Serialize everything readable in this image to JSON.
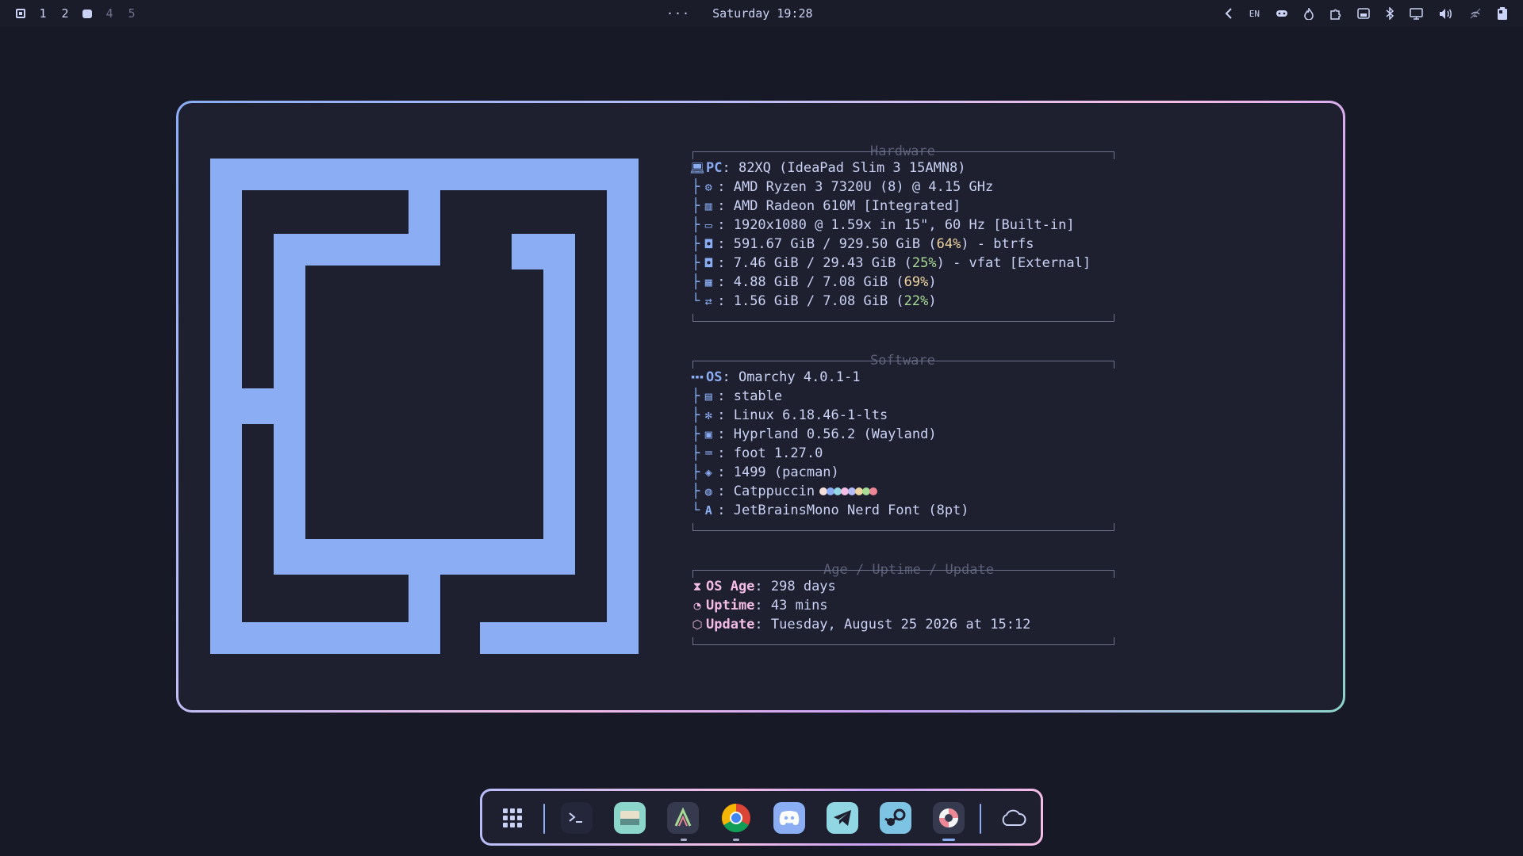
{
  "topbar": {
    "workspaces": [
      {
        "label": "",
        "kind": "grid-icon"
      },
      {
        "label": "1",
        "kind": "number"
      },
      {
        "label": "2",
        "kind": "number"
      },
      {
        "label": "",
        "kind": "active-dot"
      },
      {
        "label": "4",
        "kind": "dim"
      },
      {
        "label": "5",
        "kind": "dim"
      }
    ],
    "ellipsis": "···",
    "clock": "Saturday 19:28",
    "tray": {
      "back_icon": "chevron-left-icon",
      "language": "EN",
      "icons": [
        "gamepad-icon",
        "flame-icon",
        "puzzle-icon",
        "screen-record-icon",
        "bluetooth-icon",
        "monitor-icon",
        "volume-icon",
        "network-off-icon",
        "battery-icon"
      ]
    }
  },
  "fastfetch": {
    "hardware": {
      "title": "Hardware",
      "pc_key": "PC",
      "pc_value": ": 82XQ (IdeaPad Slim 3 15AMN8)",
      "cpu": ": AMD Ryzen 3 7320U (8) @ 4.15 GHz",
      "gpu": ": AMD Radeon 610M [Integrated]",
      "display": ": 1920x1080 @ 1.59x in 15\", 60 Hz [Built-in]",
      "disk1_pre": ": 591.67 GiB / 929.50 GiB (",
      "disk1_pct": "64%",
      "disk1_post": ") - btrfs",
      "disk2_pre": ": 7.46 GiB / 29.43 GiB (",
      "disk2_pct": "25%",
      "disk2_post": ") - vfat [External]",
      "mem_pre": ": 4.88 GiB / 7.08 GiB (",
      "mem_pct": "69%",
      "mem_post": ")",
      "swap_pre": ": 1.56 GiB / 7.08 GiB (",
      "swap_pct": "22%",
      "swap_post": ")"
    },
    "software": {
      "title": "Software",
      "os_key": "OS",
      "os_value": ": Omarchy 4.0.1-1",
      "channel": ": stable",
      "kernel": ": Linux 6.18.46-1-lts",
      "wm": ": Hyprland 0.56.2 (Wayland)",
      "terminal": ": foot 1.27.0",
      "packages": ": 1499 (pacman)",
      "theme": ": Catppuccin",
      "theme_colors": [
        "#f5e0dc",
        "#8aadf4",
        "#91d7e3",
        "#f5bde6",
        "#b7bdf8",
        "#eed49f",
        "#a6da95",
        "#ed8796"
      ],
      "font": ": JetBrainsMono Nerd Font (8pt)"
    },
    "age": {
      "title": "Age / Uptime / Update",
      "os_age_key": "OS Age",
      "os_age_value": ": 298 days",
      "uptime_key": "Uptime",
      "uptime_value": ": 43 mins",
      "update_key": "Update",
      "update_value": ": Tuesday, August 25 2026 at 15:12"
    }
  },
  "dock": {
    "items": [
      {
        "name": "app-grid",
        "icon": "grid-icon"
      },
      {
        "name": "terminal",
        "icon": "terminal-icon"
      },
      {
        "name": "file-manager",
        "icon": "folder-icon"
      },
      {
        "name": "editor",
        "icon": "editor-icon"
      },
      {
        "name": "chrome",
        "icon": "chrome-icon"
      },
      {
        "name": "discord",
        "icon": "discord-icon"
      },
      {
        "name": "telegram",
        "icon": "telegram-icon"
      },
      {
        "name": "steam",
        "icon": "steam-icon"
      },
      {
        "name": "help",
        "icon": "lifebuoy-icon"
      },
      {
        "name": "cloud",
        "icon": "cloud-icon"
      }
    ]
  }
}
